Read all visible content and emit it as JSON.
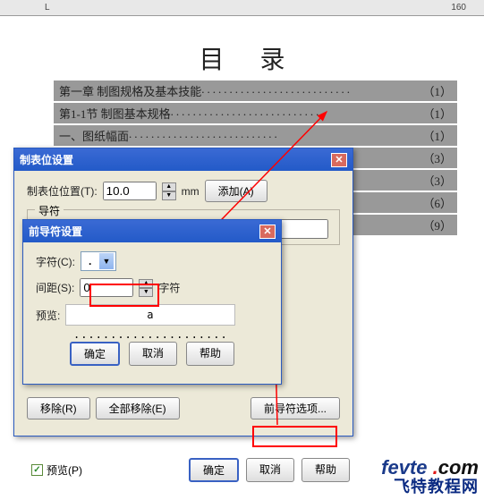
{
  "ruler": {
    "left_mark": "L",
    "right_mark": "160"
  },
  "doc": {
    "title": "目录"
  },
  "toc": [
    {
      "title": "第一章  制图规格及基本技能",
      "page": "（1）"
    },
    {
      "title": "  第1-1节  制图基本规格",
      "page": "（1）"
    },
    {
      "title": "    一、图纸幅面",
      "page": "（1）"
    },
    {
      "title": "",
      "page": "（3）"
    },
    {
      "title": "",
      "page": "（3）"
    },
    {
      "title": "",
      "page": "（6）"
    },
    {
      "title": "",
      "page": "（9）"
    }
  ],
  "dlg_main": {
    "title": "制表位设置",
    "pos_label": "制表位位置(T):",
    "pos_value": "10.0",
    "unit": "mm",
    "add_btn": "添加(A)",
    "leader_caption": "导符",
    "remove_btn": "移除(R)",
    "remove_all_btn": "全部移除(E)",
    "leader_opt_btn": "前导符选项...",
    "preview_check": "预览(P)",
    "ok_btn": "确定",
    "cancel_btn": "取消",
    "help_btn": "帮助"
  },
  "dlg_sub": {
    "title": "前导符设置",
    "char_label": "字符(C):",
    "char_value": ".",
    "spacing_label": "间距(S):",
    "spacing_value": "0",
    "spacing_unit": "字符",
    "preview_label": "预览:",
    "preview_text": "a ..................... b",
    "ok_btn": "确定",
    "cancel_btn": "取消",
    "help_btn": "帮助"
  },
  "watermark": {
    "brand": "fevte",
    "dot": " .",
    "com": "com",
    "line2": "飞特教程网"
  }
}
